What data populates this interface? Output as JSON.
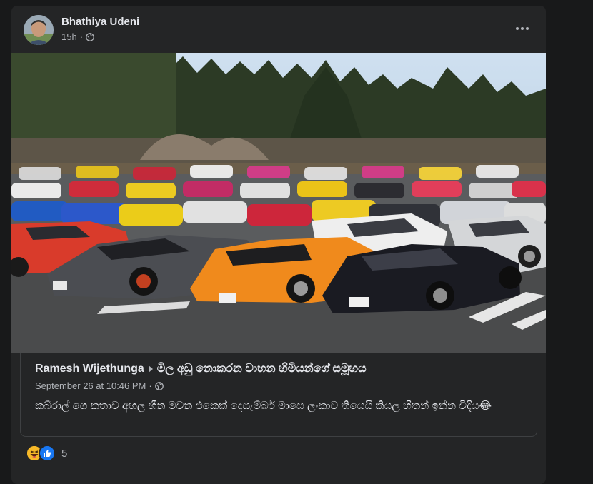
{
  "post": {
    "author": "Bhathiya Udeni",
    "time": "15h",
    "separator": "·"
  },
  "shared": {
    "author": "Ramesh Wijethunga",
    "group": "මිල අඩු නොකරන වාහන හිමියන්ගේ සමූහය",
    "date": "September 26 at 10:46 PM",
    "separator": "·",
    "text": "කබ්රාල් ගෙ කතාව අහල හීන මවන එකෙක් දෙසැම්බර් මාසෙ ලංකාව තියෙයි කියල හිතන් ඉන්න විදිය😂"
  },
  "reactions": {
    "count": "5",
    "icons": [
      "laughing-emoji-icon",
      "like-icon"
    ]
  },
  "colors": {
    "background": "#18191a",
    "card": "#242526",
    "text_primary": "#e4e6eb",
    "text_secondary": "#b0b3b8",
    "like_blue": "#1877f2"
  }
}
